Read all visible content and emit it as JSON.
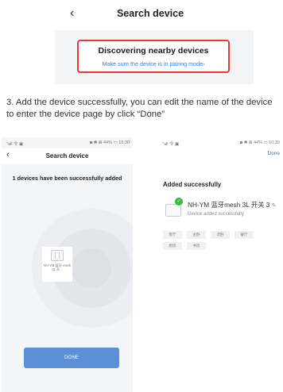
{
  "top": {
    "back_icon": "‹",
    "title": "Search device"
  },
  "banner": {
    "title": "Discovering nearby devices",
    "subtitle": "Make sure the device is in pairing mode›"
  },
  "instruction": "3. Add the device successfully, you can edit the name of the device to enter the device page by click “Done”",
  "left_phone": {
    "status_left": "\"all 令 ▣",
    "status_right": "◙ ✱ ⊠ 44% ▭ 10:30",
    "back_icon": "‹",
    "title": "Search device",
    "success_text": "1 devices have been successfully added",
    "device_name": "NH-YM 蓝牙 mesh 3L 开...",
    "done_label": "DONE"
  },
  "right_phone": {
    "status_left": "\"all 令 ▣",
    "status_right": "◙ ✱ ⊠ 44% ▭ 10:30",
    "done_label": "Done",
    "title": "Added successfully",
    "device_name": "NH-YM 蓝牙mesh 3L 开关 3",
    "edit_icon": "✎",
    "status": "Device added successfully",
    "rooms": [
      "客厅",
      "主卧",
      "次卧",
      "餐厅",
      "厨房",
      "书房"
    ]
  }
}
